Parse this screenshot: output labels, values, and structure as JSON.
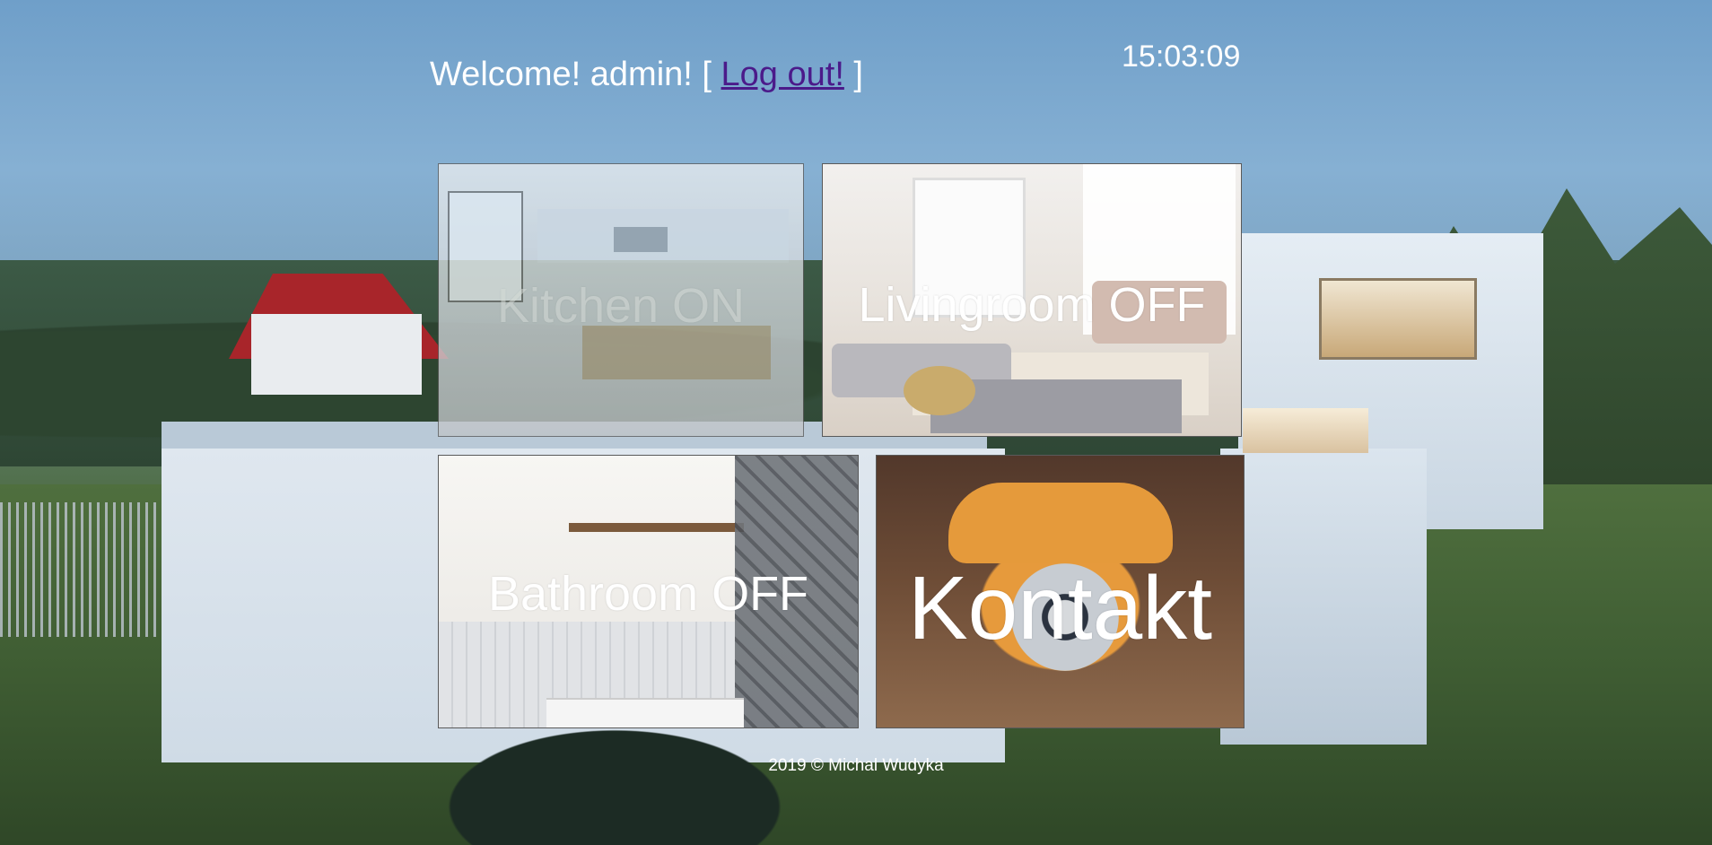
{
  "header": {
    "welcome_prefix": "Welcome! admin! [ ",
    "logout_label": "Log out!",
    "welcome_suffix": " ]",
    "clock": "15:03:09"
  },
  "tiles": {
    "kitchen": "Kitchen ON",
    "livingroom": "Livingroom OFF",
    "bathroom": "Bathroom OFF",
    "contact": "Kontakt"
  },
  "footer": {
    "text": "2019 © Michal Wudyka"
  },
  "colors": {
    "link": "#4b1a8a",
    "text": "#ffffff"
  }
}
